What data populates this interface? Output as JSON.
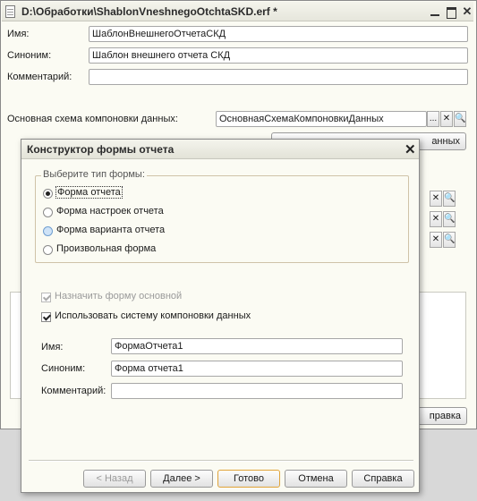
{
  "main": {
    "title": "D:\\Обработки\\ShablonVneshnegoOtchtaSKD.erf *",
    "name_label": "Имя:",
    "name_value": "ШаблонВнешнегоОтчетаСКД",
    "synonym_label": "Синоним:",
    "synonym_value": "Шаблон внешнего отчета СКД",
    "comment_label": "Комментарий:",
    "comment_value": "",
    "schema_label": "Основная схема компоновки данных:",
    "schema_value": "ОсновнаяСхемаКомпоновкиДанных",
    "schema_ellipsis": "...",
    "clear_glyph": "✕",
    "search_glyph": "🔍",
    "open_schema_btn_tail": "анных",
    "help_btn_tail": "правка"
  },
  "dialog": {
    "title": "Конструктор формы отчета",
    "close_glyph": "✕",
    "group_title": "Выберите тип формы:",
    "radios": [
      {
        "label": "Форма отчета",
        "checked": true
      },
      {
        "label": "Форма настроек отчета",
        "checked": false
      },
      {
        "label": "Форма варианта отчета",
        "checked": false
      },
      {
        "label": "Произвольная форма",
        "checked": false
      }
    ],
    "check_main_form": "Назначить форму основной",
    "check_use_dcs": "Использовать систему компоновки данных",
    "name_label": "Имя:",
    "name_value": "ФормаОтчета1",
    "synonym_label": "Синоним:",
    "synonym_value": "Форма отчета1",
    "comment_label": "Комментарий:",
    "comment_value": "",
    "buttons": {
      "back": "< Назад",
      "next": "Далее >",
      "done": "Готово",
      "cancel": "Отмена",
      "help": "Справка"
    }
  }
}
